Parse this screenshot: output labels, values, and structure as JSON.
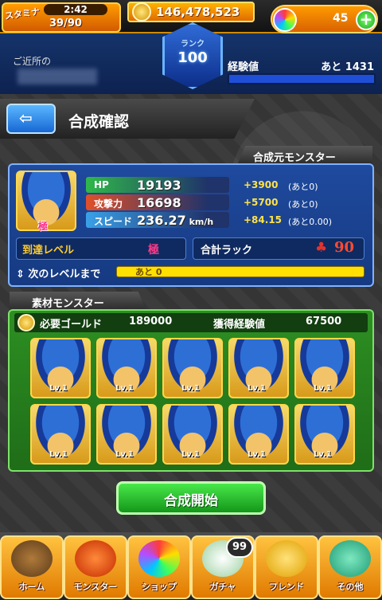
{
  "stamina": {
    "label": "スタミナ",
    "time": "2:42",
    "value": "39/90"
  },
  "gold": {
    "amount": "146,478,523"
  },
  "orbs": {
    "count": "45",
    "add_label": "+"
  },
  "location": {
    "label": "ご近所の"
  },
  "rank": {
    "label": "ランク",
    "value": "100"
  },
  "experience": {
    "label": "経験値",
    "remaining": "あと 1431"
  },
  "header": {
    "back_label": "⇦",
    "title": "合成確認"
  },
  "base_monster": {
    "section_label": "合成元モンスター",
    "badge": "極",
    "stats": [
      {
        "label": "HP",
        "value": "19193",
        "unit": "",
        "plus": "+3900",
        "paren": "(あと0)",
        "color": "#2fb84a"
      },
      {
        "label": "攻撃力",
        "value": "16698",
        "unit": "",
        "plus": "+5700",
        "paren": "(あと0)",
        "color": "#e0502a"
      },
      {
        "label": "スピード",
        "value": "236.27",
        "unit": "km/h",
        "plus": "+84.15",
        "paren": "(あと0.00)",
        "color": "#3aa0e8"
      }
    ],
    "level_label": "到達レベル",
    "level_value": "極",
    "luck_label": "合計ラック",
    "luck_icon": "clover-icon",
    "luck_value": "90",
    "next_level_label": "次のレベルまで",
    "next_level_text": "あと 0",
    "next_level_fill": 1.0
  },
  "materials": {
    "section_label": "素材モンスター",
    "gold_label": "必要ゴールド",
    "gold_value": "189000",
    "exp_label": "獲得経験値",
    "exp_value": "67500",
    "level_text": "Lv.1",
    "count": 10
  },
  "actions": {
    "start_label": "合成開始"
  },
  "nav": [
    {
      "label": "ホーム",
      "icon": "home-icon"
    },
    {
      "label": "モンスター",
      "icon": "monster-icon"
    },
    {
      "label": "ショップ",
      "icon": "shop-orb-icon"
    },
    {
      "label": "ガチャ",
      "icon": "gacha-egg-icon",
      "badge": "99"
    },
    {
      "label": "フレンド",
      "icon": "friend-balloon-icon"
    },
    {
      "label": "その他",
      "icon": "other-icon"
    }
  ]
}
